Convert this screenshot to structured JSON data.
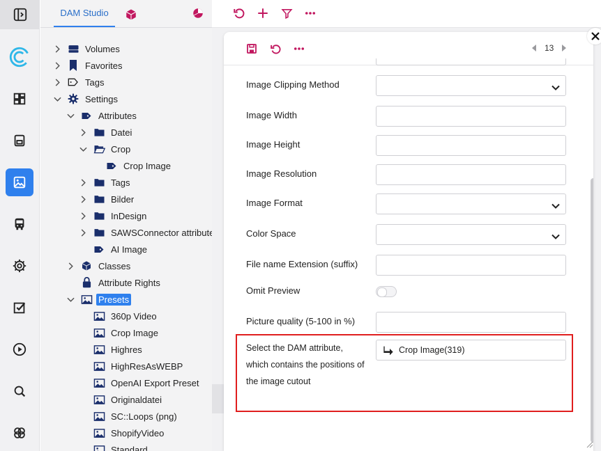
{
  "app": {
    "accent": "#2f80ed",
    "action_color": "#c1175f"
  },
  "rail": {
    "items": [
      "panel-toggle-icon",
      "logo-icon",
      "dashboard-icon",
      "save-icon",
      "image-icon",
      "bus-icon",
      "settings-icon",
      "checkbox-icon",
      "play-icon",
      "search-icon",
      "workflow-icon"
    ],
    "active": "image-icon"
  },
  "tree_panel": {
    "tab_label": "DAM Studio",
    "rows": [
      {
        "label": "Volumes",
        "icon": "drive-icon",
        "level": 0,
        "expander": "collapsed"
      },
      {
        "label": "Favorites",
        "icon": "bookmark-icon",
        "level": 0,
        "expander": "collapsed"
      },
      {
        "label": "Tags",
        "icon": "tag-outline-icon",
        "level": 0,
        "expander": "collapsed"
      },
      {
        "label": "Settings",
        "icon": "gear-icon",
        "level": 0,
        "expander": "expanded"
      },
      {
        "label": "Attributes",
        "icon": "tag-icon",
        "level": 1,
        "expander": "expanded"
      },
      {
        "label": "Datei",
        "icon": "folder-icon",
        "level": 2,
        "expander": "collapsed"
      },
      {
        "label": "Crop",
        "icon": "folder-open-icon",
        "level": 2,
        "expander": "expanded"
      },
      {
        "label": "Crop Image",
        "icon": "tag-icon",
        "level": 3,
        "expander": "none"
      },
      {
        "label": "Tags",
        "icon": "folder-icon",
        "level": 2,
        "expander": "collapsed"
      },
      {
        "label": "Bilder",
        "icon": "folder-icon",
        "level": 2,
        "expander": "collapsed"
      },
      {
        "label": "InDesign",
        "icon": "folder-icon",
        "level": 2,
        "expander": "collapsed"
      },
      {
        "label": "SAWSConnector attributes",
        "icon": "folder-icon",
        "level": 2,
        "expander": "collapsed"
      },
      {
        "label": "AI Image",
        "icon": "tag-icon",
        "level": 2,
        "expander": "none"
      },
      {
        "label": "Classes",
        "icon": "cube-icon",
        "level": 1,
        "expander": "collapsed"
      },
      {
        "label": "Attribute Rights",
        "icon": "lock-icon",
        "level": 1,
        "expander": "none"
      },
      {
        "label": "Presets",
        "icon": "picture-icon",
        "level": 1,
        "expander": "expanded",
        "selected": true
      },
      {
        "label": "360p Video",
        "icon": "picture-icon",
        "level": 2,
        "expander": "none"
      },
      {
        "label": "Crop Image",
        "icon": "picture-icon",
        "level": 2,
        "expander": "none"
      },
      {
        "label": "Highres",
        "icon": "picture-icon",
        "level": 2,
        "expander": "none"
      },
      {
        "label": "HighResAsWEBP",
        "icon": "picture-icon",
        "level": 2,
        "expander": "none"
      },
      {
        "label": "OpenAI Export Preset",
        "icon": "picture-icon",
        "level": 2,
        "expander": "none"
      },
      {
        "label": "Originaldatei",
        "icon": "picture-icon",
        "level": 2,
        "expander": "none"
      },
      {
        "label": "SC::Loops (png)",
        "icon": "picture-icon",
        "level": 2,
        "expander": "none"
      },
      {
        "label": "ShopifyVideo",
        "icon": "picture-icon",
        "level": 2,
        "expander": "none"
      },
      {
        "label": "Standard",
        "icon": "picture-icon",
        "level": 2,
        "expander": "none"
      }
    ]
  },
  "toolbar": {
    "icons": [
      "refresh-icon",
      "add-icon",
      "filter-icon",
      "more-icon"
    ]
  },
  "card": {
    "toolbar_icons": [
      "save-icon",
      "refresh-icon",
      "more-icon"
    ],
    "page": "13",
    "fields": [
      {
        "label": "Image Clipping Method",
        "type": "select",
        "value": ""
      },
      {
        "label": "Image Width",
        "type": "text",
        "value": ""
      },
      {
        "label": "Image Height",
        "type": "text",
        "value": ""
      },
      {
        "label": "Image Resolution",
        "type": "text",
        "value": ""
      },
      {
        "label": "Image Format",
        "type": "select",
        "value": ""
      },
      {
        "label": "Color Space",
        "type": "select",
        "value": ""
      },
      {
        "label": "File name Extension (suffix)",
        "type": "text",
        "value": ""
      },
      {
        "label": "Omit Preview",
        "type": "toggle",
        "value": false
      },
      {
        "label": "Picture quality (5-100 in %)",
        "type": "text",
        "value": ""
      }
    ],
    "crop_attribute": {
      "label": "Select the DAM attribute, which contains the positions of the image cutout",
      "value": "Crop Image(319)"
    }
  }
}
